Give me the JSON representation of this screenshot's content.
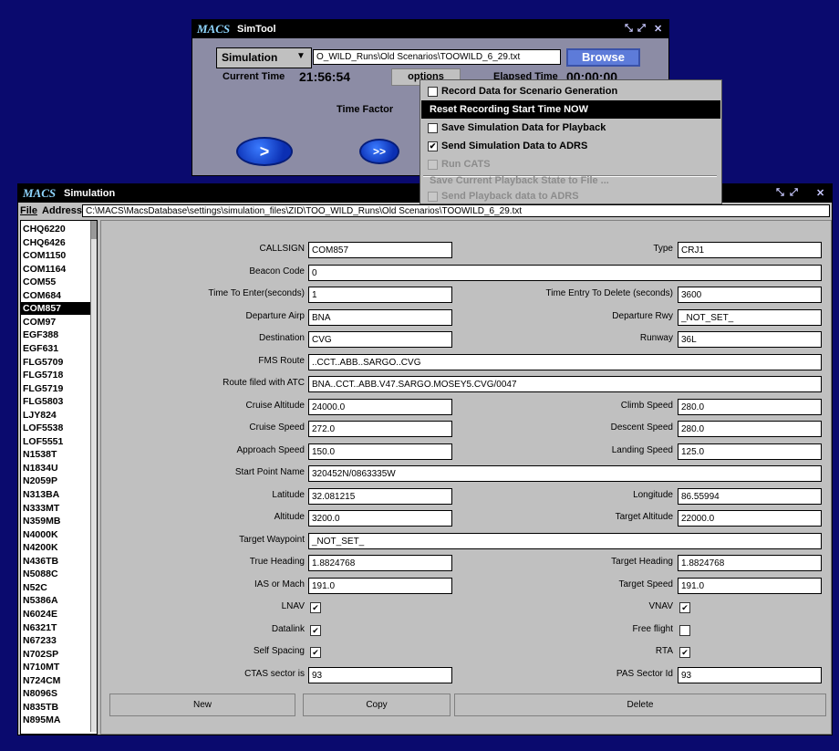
{
  "simtool": {
    "logo": "MACS",
    "title": "SimTool",
    "mode_select": "Simulation",
    "file_value": "O_WILD_Runs\\Old Scenarios\\TOOWILD_6_29.txt",
    "browse_label": "Browse",
    "current_time_label": "Current Time",
    "current_time": "21:56:54",
    "options_label": "options",
    "elapsed_label": "Elapsed Time",
    "elapsed_time": "00:00:00",
    "time_factor_label": "Time Factor",
    "play_label": ">",
    "fast_label": ">>"
  },
  "options_menu": {
    "items": [
      {
        "label": "Record Data for Scenario Generation",
        "checked": false
      },
      {
        "label": "Reset Recording Start Time NOW"
      },
      {
        "label": "Save Simulation Data for Playback",
        "checked": false
      },
      {
        "label": "Send Simulation Data to ADRS",
        "checked": true
      },
      {
        "label": "Run CATS",
        "checked": false
      },
      {
        "label": "Save Current Playback State to File ..."
      },
      {
        "label": "Send Playback data to ADRS",
        "checked": false
      }
    ]
  },
  "simulation": {
    "logo": "MACS",
    "title": "Simulation",
    "menu_file": "File",
    "address_label": "Address",
    "address_value": "C:\\MACS\\MacsDatabase\\settings\\simulation_files\\ZID\\TOO_WILD_Runs\\Old Scenarios\\TOOWILD_6_29.txt",
    "selected_callsign": "COM857",
    "callsigns": [
      "CHQ6220",
      "CHQ6426",
      "COM1150",
      "COM1164",
      "COM55",
      "COM684",
      "COM857",
      "COM97",
      "EGF388",
      "EGF631",
      "FLG5709",
      "FLG5718",
      "FLG5719",
      "FLG5803",
      "LJY824",
      "LOF5538",
      "LOF5551",
      "N1538T",
      "N1834U",
      "N2059P",
      "N313BA",
      "N333MT",
      "N359MB",
      "N4000K",
      "N4200K",
      "N436TB",
      "N5088C",
      "N52C",
      "N5386A",
      "N6024E",
      "N6321T",
      "N67233",
      "N702SP",
      "N710MT",
      "N724CM",
      "N8096S",
      "N835TB",
      "N895MA"
    ]
  },
  "form": {
    "callsign": {
      "label": "CALLSIGN",
      "value": "COM857"
    },
    "type": {
      "label": "Type",
      "value": "CRJ1"
    },
    "beacon": {
      "label": "Beacon Code",
      "value": "0"
    },
    "time_enter": {
      "label": "Time To Enter(seconds)",
      "value": "1"
    },
    "time_delete": {
      "label": "Time Entry To Delete (seconds)",
      "value": "3600"
    },
    "dep_airp": {
      "label": "Departure Airp",
      "value": "BNA"
    },
    "dep_rwy": {
      "label": "Departure Rwy",
      "value": "_NOT_SET_"
    },
    "destination": {
      "label": "Destination",
      "value": "CVG"
    },
    "runway": {
      "label": "Runway",
      "value": "36L"
    },
    "fms_route": {
      "label": "FMS Route",
      "value": "..CCT..ABB..SARGO..CVG"
    },
    "route_atc": {
      "label": "Route filed with ATC",
      "value": "BNA..CCT..ABB.V47.SARGO.MOSEY5.CVG/0047"
    },
    "cruise_alt": {
      "label": "Cruise Altitude",
      "value": "24000.0"
    },
    "climb_speed": {
      "label": "Climb Speed",
      "value": "280.0"
    },
    "cruise_speed": {
      "label": "Cruise Speed",
      "value": "272.0"
    },
    "descent_speed": {
      "label": "Descent Speed",
      "value": "280.0"
    },
    "approach_speed": {
      "label": "Approach Speed",
      "value": "150.0"
    },
    "landing_speed": {
      "label": "Landing Speed",
      "value": "125.0"
    },
    "start_point": {
      "label": "Start Point Name",
      "value": "320452N/0863335W"
    },
    "latitude": {
      "label": "Latitude",
      "value": "32.081215"
    },
    "longitude": {
      "label": "Longitude",
      "value": "86.55994"
    },
    "altitude": {
      "label": "Altitude",
      "value": "3200.0"
    },
    "target_alt": {
      "label": "Target Altitude",
      "value": "22000.0"
    },
    "target_wp": {
      "label": "Target Waypoint",
      "value": "_NOT_SET_"
    },
    "true_heading": {
      "label": "True Heading",
      "value": "1.8824768"
    },
    "target_heading": {
      "label": "Target Heading",
      "value": "1.8824768"
    },
    "ias_mach": {
      "label": "IAS or Mach",
      "value": "191.0"
    },
    "target_speed": {
      "label": "Target Speed",
      "value": "191.0"
    },
    "lnav": {
      "label": "LNAV",
      "checked": true
    },
    "vnav": {
      "label": "VNAV",
      "checked": true
    },
    "datalink": {
      "label": "Datalink",
      "checked": true
    },
    "free_flight": {
      "label": "Free flight",
      "checked": false
    },
    "self_spacing": {
      "label": "Self Spacing",
      "checked": true
    },
    "rta": {
      "label": "RTA",
      "checked": true
    },
    "ctas_sector": {
      "label": "CTAS sector is",
      "value": "93"
    },
    "pas_sector": {
      "label": "PAS Sector Id",
      "value": "93"
    },
    "new_label": "New",
    "copy_label": "Copy",
    "delete_label": "Delete"
  }
}
